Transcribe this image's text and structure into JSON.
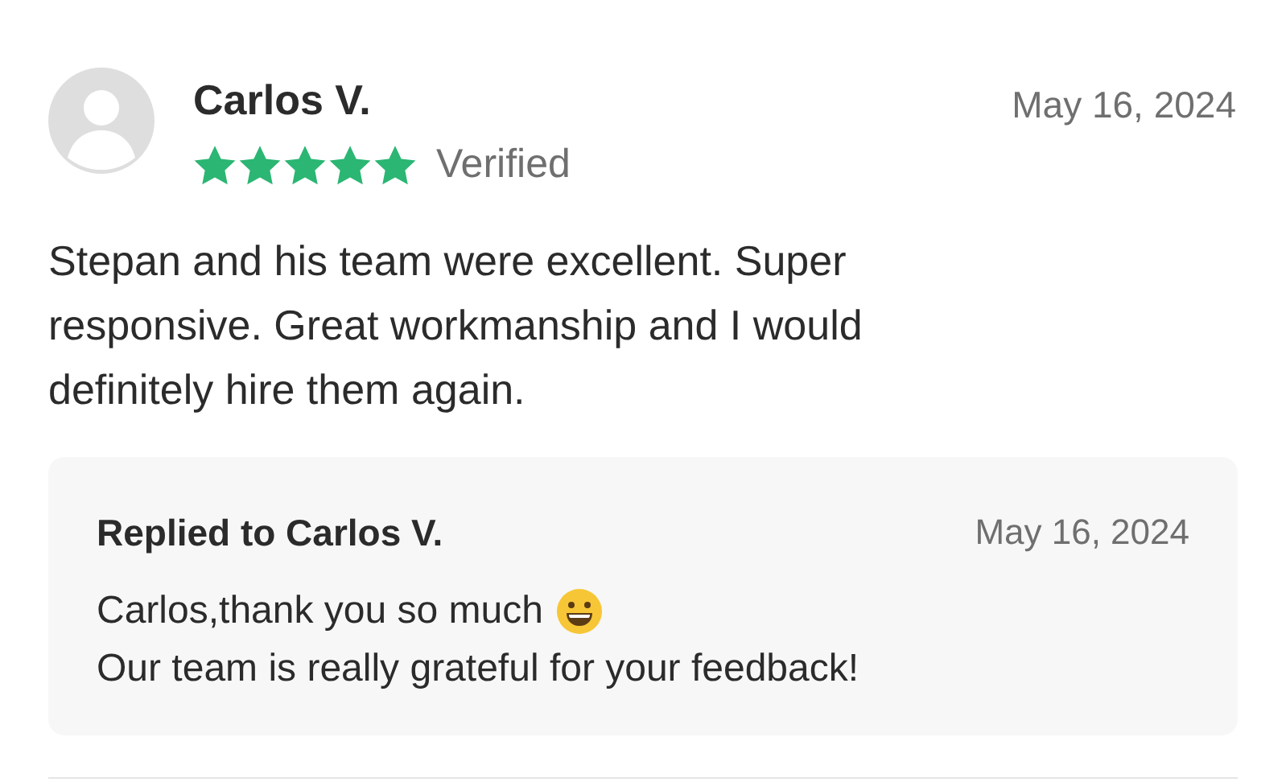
{
  "review": {
    "author": "Carlos V.",
    "stars": 5,
    "verified": true,
    "verified_label": "Verified",
    "date": "May 16, 2024",
    "text": "Stepan and his team were excellent. Super responsive. Great workmanship and I would definitely hire them again."
  },
  "reply": {
    "title": "Replied to Carlos V.",
    "date": "May 16, 2024",
    "lines": [
      "Carlos,thank you so much",
      "Our team is really grateful for your feedback!"
    ]
  }
}
